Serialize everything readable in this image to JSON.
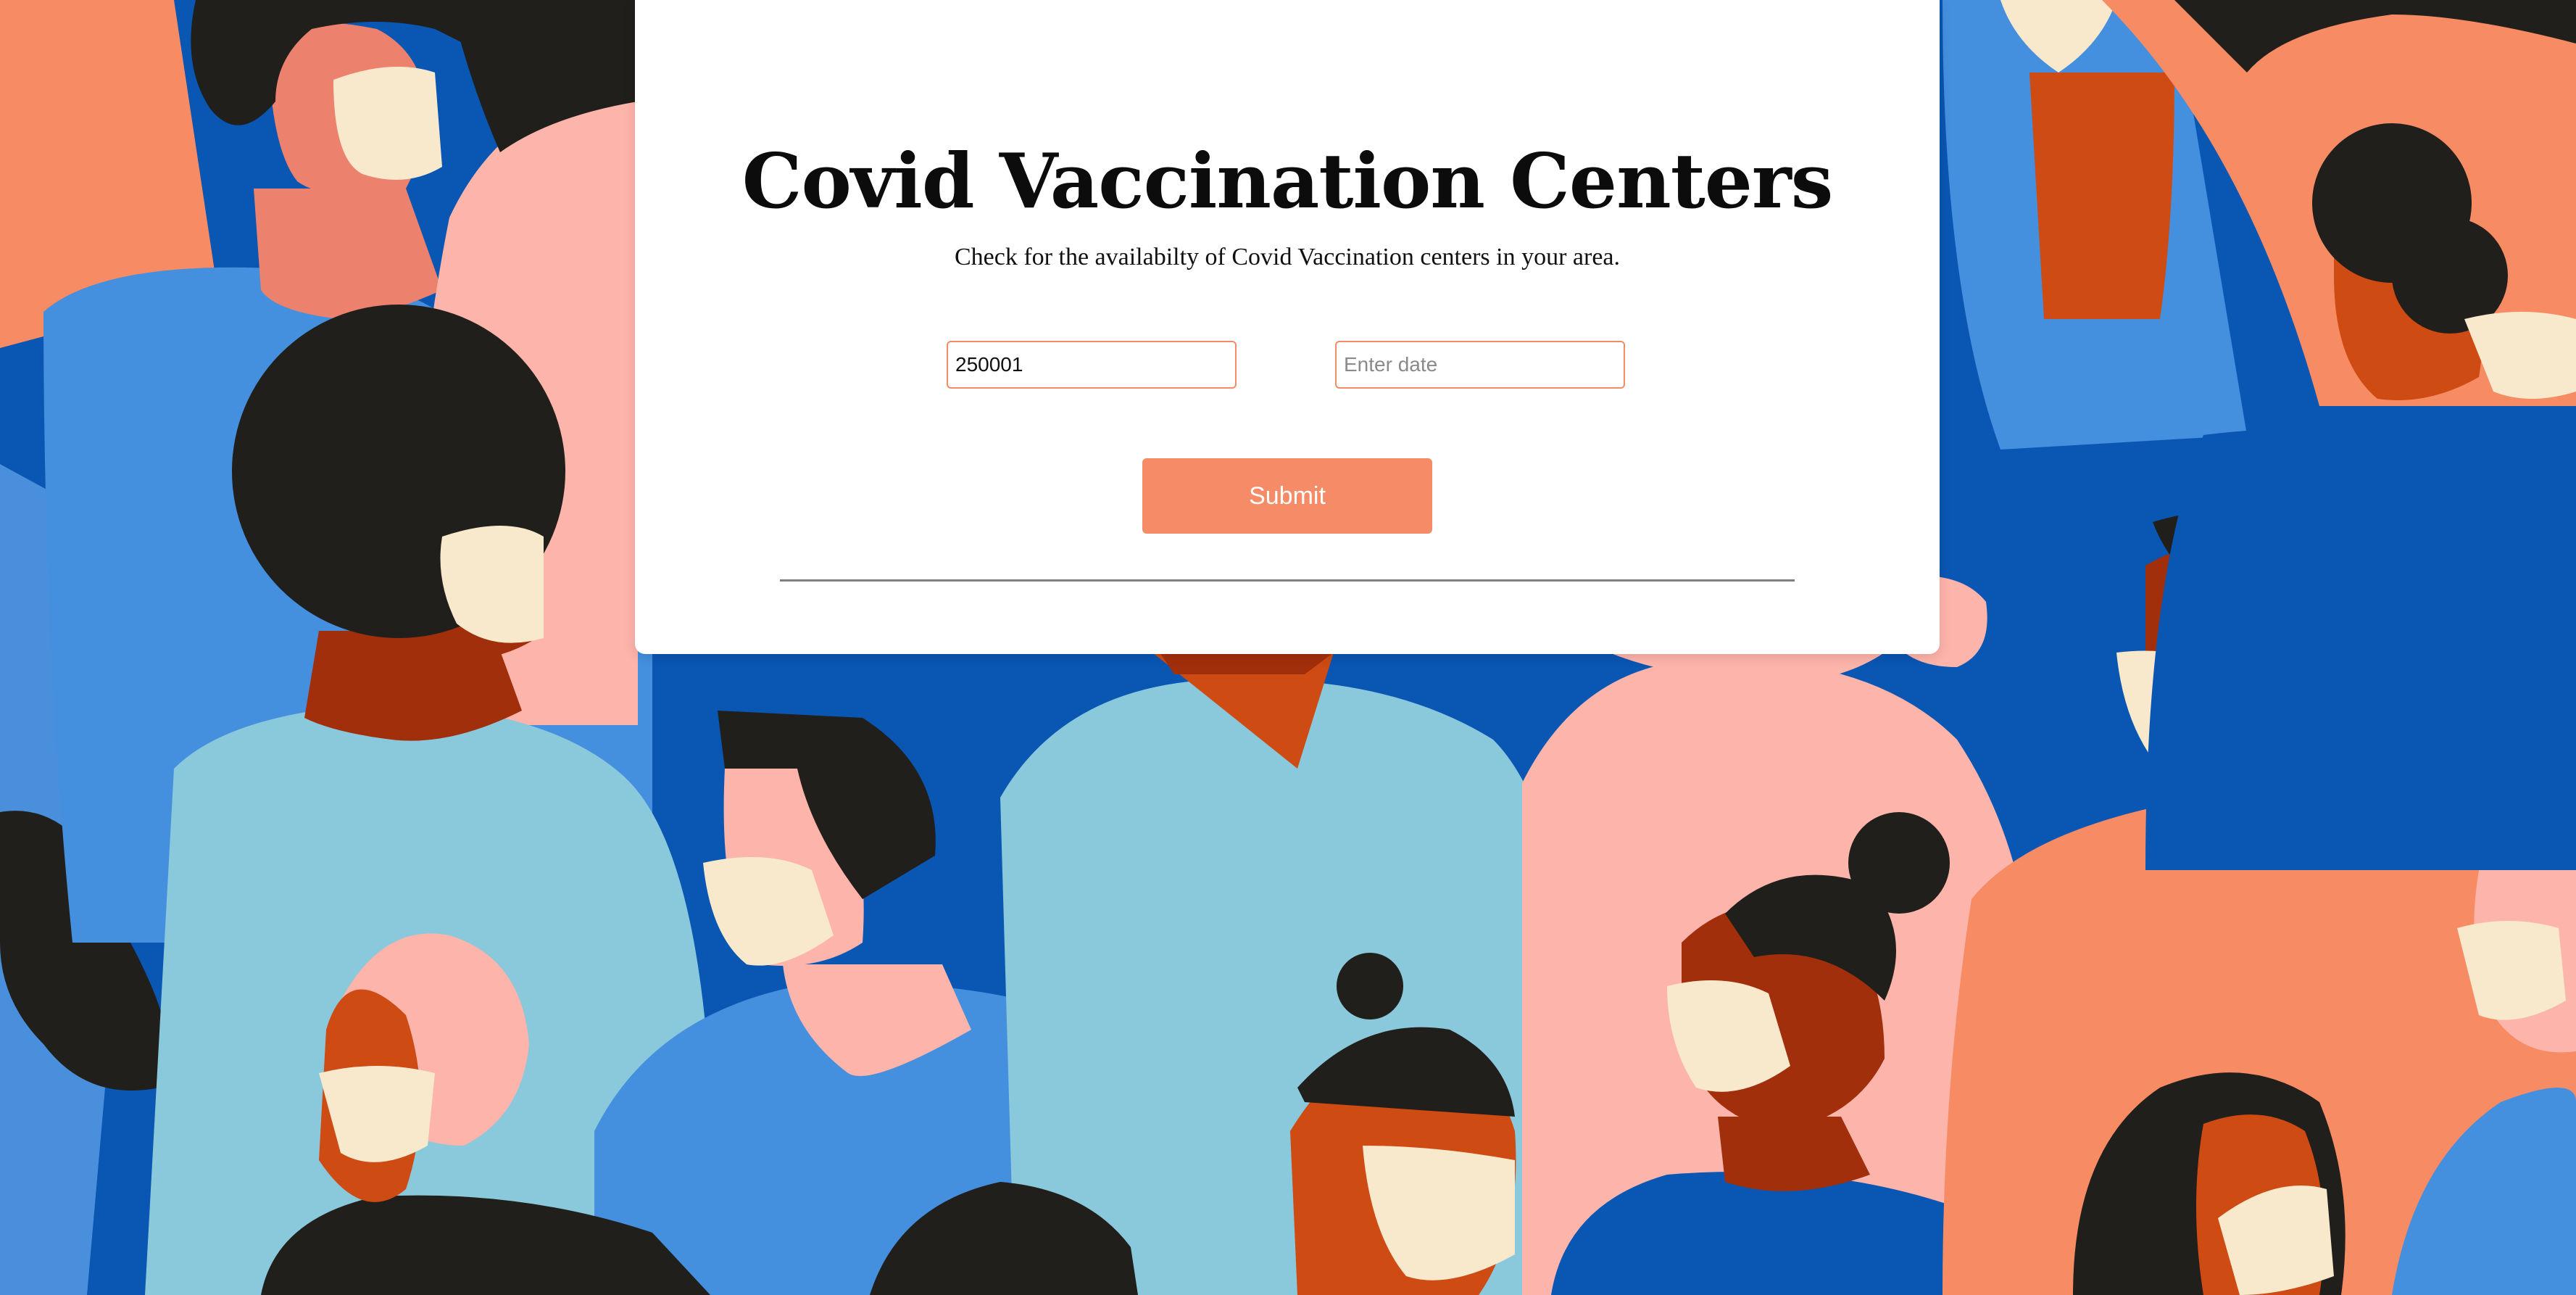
{
  "page": {
    "title": "Covid Vaccination Centers",
    "subtitle": "Check for the availabilty of Covid Vaccination centers in your area."
  },
  "form": {
    "pincode_value": "250001",
    "date_placeholder": "Enter date",
    "submit_label": "Submit"
  },
  "colors": {
    "accent": "#f58b67",
    "input_border": "#f28c66",
    "background_blue": "#0a56b3",
    "card": "#ffffff"
  },
  "background": {
    "description_icon": "crowd-with-masks-illustration"
  }
}
